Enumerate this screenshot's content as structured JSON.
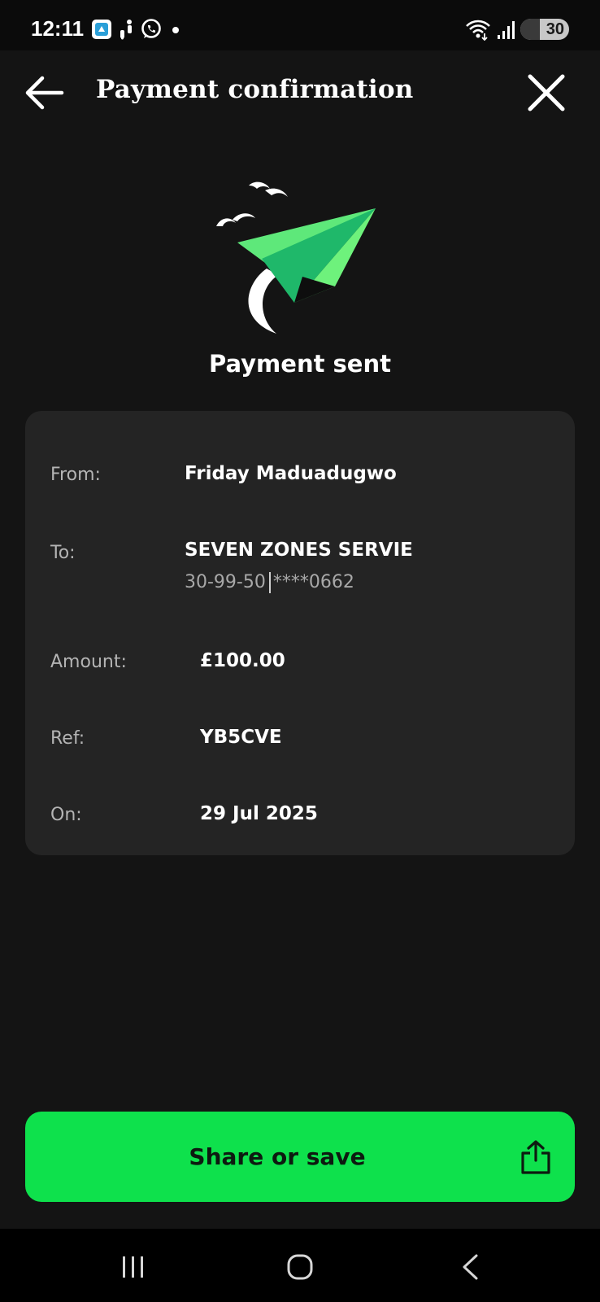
{
  "status_bar": {
    "time": "12:11",
    "battery_level": "30",
    "left_icons": [
      "app-notification-icon",
      "running-icon",
      "whatsapp-icon",
      "dot-icon"
    ],
    "right_icons": [
      "wifi-icon",
      "signal-icon",
      "battery-icon"
    ]
  },
  "header": {
    "title": "Payment confirmation",
    "back_icon": "arrow-left-icon",
    "close_icon": "close-icon"
  },
  "hero": {
    "illustration": "paper-plane-icon",
    "heading": "Payment sent",
    "plane_color": "#5ee87a"
  },
  "details": {
    "from_label": "From:",
    "from_value": "Friday Maduadugwo",
    "to_label": "To:",
    "to_name": "SEVEN ZONES SERVIE",
    "to_sort_code": "30-99-50",
    "to_account": "****0662",
    "amount_label": "Amount:",
    "amount_value": "£100.00",
    "ref_label": "Ref:",
    "ref_value": "YB5CVE",
    "on_label": "On:",
    "on_value": "29 Jul 2025"
  },
  "actions": {
    "share_label": "Share or save",
    "share_icon": "share-icon",
    "accent_color": "#0ee14c"
  },
  "nav_bar": {
    "items": [
      "recents-icon",
      "home-icon",
      "back-icon"
    ]
  }
}
